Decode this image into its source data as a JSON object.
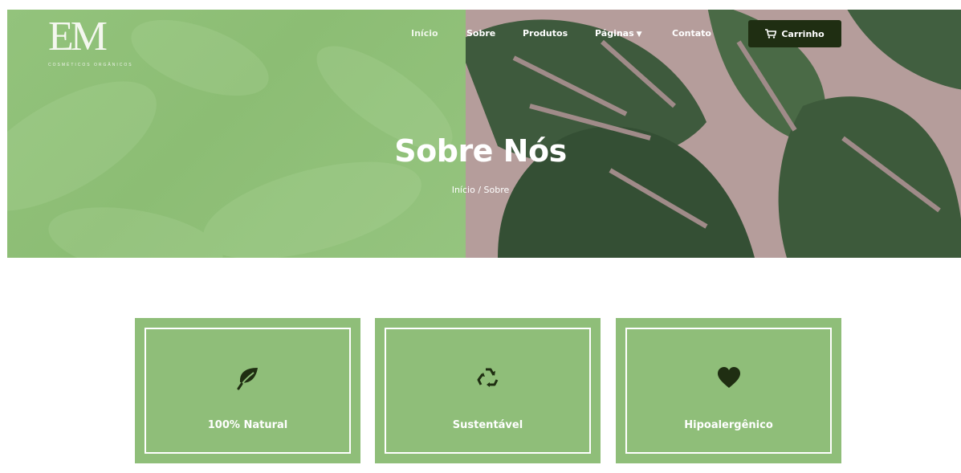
{
  "logo": {
    "mark": "EM",
    "subtitle": "COSMÉTICOS ORGÂNICOS"
  },
  "nav": {
    "items": [
      {
        "label": "Início",
        "active": true
      },
      {
        "label": "Sobre",
        "active": false
      },
      {
        "label": "Produtos",
        "active": false
      },
      {
        "label": "Páginas",
        "active": false,
        "has_dropdown": true
      },
      {
        "label": "Contato",
        "active": false
      }
    ],
    "cart_label": "Carrinho"
  },
  "hero": {
    "title": "Sobre Nós",
    "breadcrumb": {
      "home": "Início",
      "separator": "/",
      "current": "Sobre"
    }
  },
  "features": [
    {
      "label": "100% Natural",
      "icon": "leaf-icon"
    },
    {
      "label": "Sustentável",
      "icon": "recycle-icon"
    },
    {
      "label": "Hipoalergênico",
      "icon": "heart-icon"
    }
  ],
  "colors": {
    "accent_green": "#8fbe79",
    "dark_green": "#1f2e12",
    "white": "#ffffff"
  }
}
